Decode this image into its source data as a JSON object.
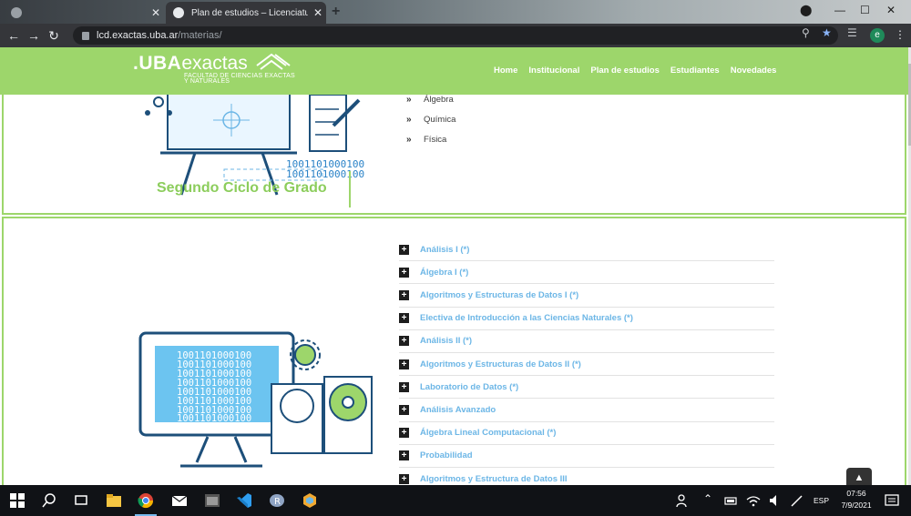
{
  "browser": {
    "tabs": [
      {
        "title": "",
        "active": false
      },
      {
        "title": "Plan de estudios – Licenciatura e",
        "active": true
      }
    ],
    "new_tab": "+",
    "url_host": "lcd.exactas.uba.ar",
    "url_path": "/materias/",
    "profile_initial": "e"
  },
  "site": {
    "logo": {
      "uba": ".UBA",
      "exactas": "exactas",
      "subtitle_line1": "FACULTAD DE CIENCIAS EXACTAS",
      "subtitle_line2": "Y NATURALES"
    },
    "nav": [
      "Home",
      "Institucional",
      "Plan de estudios",
      "Estudiantes",
      "Novedades"
    ],
    "colors": {
      "brand_green": "#9dd66b",
      "heading_green": "#8ccd5c",
      "link_blue": "#6cb6e6"
    }
  },
  "section1": {
    "items": [
      "Álgebra",
      "Química",
      "Física"
    ],
    "binary": [
      "1001101000100",
      "1001101000100"
    ]
  },
  "section2": {
    "heading": "Segundo Ciclo de Grado",
    "binary": [
      "1001101000100",
      "1001101000100",
      "1001101000100",
      "1001101000100",
      "1001101000100",
      "1001101000100",
      "1001101000100",
      "1001101000100"
    ],
    "courses": [
      "Análisis I (*)",
      "Álgebra I (*)",
      "Algoritmos y Estructuras de Datos I (*)",
      "Electiva de Introducción a las Ciencias Naturales (*)",
      "Análisis II (*)",
      "Algoritmos y Estructuras de Datos II (*)",
      "Laboratorio de Datos (*)",
      "Análisis Avanzado",
      "Álgebra Lineal Computacional (*)",
      "Probabilidad",
      "Algoritmos y Estructura de Datos III"
    ]
  },
  "taskbar": {
    "language": "ESP",
    "time": "07:56",
    "date": "7/9/2021"
  }
}
